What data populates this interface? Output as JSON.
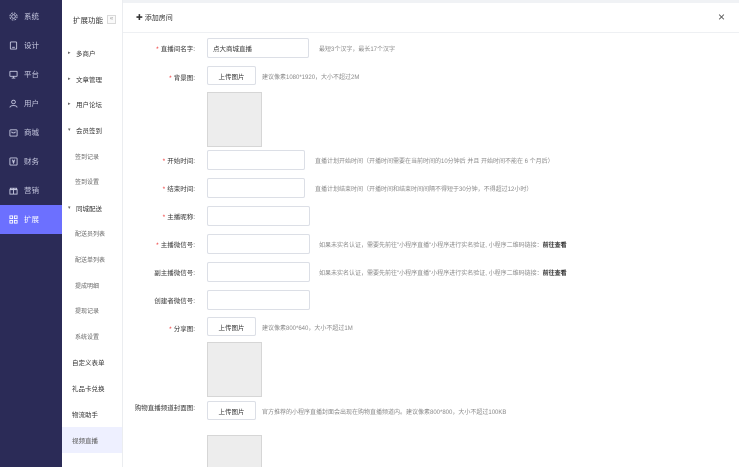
{
  "nav": {
    "items": [
      {
        "label": "系统",
        "icon": "gear-icon",
        "active": false
      },
      {
        "label": "设计",
        "icon": "design-icon",
        "active": false
      },
      {
        "label": "平台",
        "icon": "monitor-icon",
        "active": false
      },
      {
        "label": "用户",
        "icon": "user-icon",
        "active": false
      },
      {
        "label": "商城",
        "icon": "shop-icon",
        "active": false
      },
      {
        "label": "财务",
        "icon": "finance-icon",
        "active": false
      },
      {
        "label": "营销",
        "icon": "marketing-icon",
        "active": false
      },
      {
        "label": "扩展",
        "icon": "grid-icon",
        "active": true
      }
    ]
  },
  "sub": {
    "title": "扩展功能",
    "collapse_glyph": "«",
    "items": [
      {
        "label": "多商户",
        "type": "group"
      },
      {
        "label": "文章管理",
        "type": "group"
      },
      {
        "label": "用户论坛",
        "type": "group"
      },
      {
        "label": "会员签到",
        "type": "group-open"
      },
      {
        "label": "签到记录",
        "type": "child"
      },
      {
        "label": "签到设置",
        "type": "child"
      },
      {
        "label": "同城配送",
        "type": "group-open"
      },
      {
        "label": "配送员列表",
        "type": "child"
      },
      {
        "label": "配送单列表",
        "type": "child"
      },
      {
        "label": "提成明细",
        "type": "child"
      },
      {
        "label": "提现记录",
        "type": "child"
      },
      {
        "label": "系统设置",
        "type": "child"
      },
      {
        "label": "自定义表单",
        "type": "plain"
      },
      {
        "label": "礼品卡兑换",
        "type": "plain"
      },
      {
        "label": "物流助手",
        "type": "plain"
      },
      {
        "label": "视频直播",
        "type": "plain-active"
      }
    ]
  },
  "panel": {
    "title": "添加房间",
    "title_prefix": "✚",
    "close_glyph": "×"
  },
  "form": {
    "room_name": {
      "label": "直播间名字:",
      "value": "点大商城直播",
      "hint": "最短3个汉字，最长17个汉字"
    },
    "background": {
      "label": "背景图:",
      "button": "上传图片",
      "hint": "建议像素1080*1920，大小不超过2M"
    },
    "start_time": {
      "label": "开始时间:",
      "value": "",
      "hint": "直播计划开始时间（开播时间需要在当前时间的10分钟后 并且 开始时间不能在 6 个月后）"
    },
    "end_time": {
      "label": "结束时间:",
      "value": "",
      "hint": "直播计划结束时间（开播时间和结束时间间隔不得短于30分钟，不得超过12小时）"
    },
    "anchor_nick": {
      "label": "主播昵称:",
      "value": ""
    },
    "anchor_wechat": {
      "label": "主播微信号:",
      "value": "",
      "hint": "如果未实名认证，需要先前往\"小程序直播\"小程序进行实名验证, 小程序二维码链接：",
      "link": "前往查看"
    },
    "sub_anchor_wechat": {
      "label": "副主播微信号:",
      "value": "",
      "hint": "如果未实名认证，需要先前往\"小程序直播\"小程序进行实名验证, 小程序二维码链接：",
      "link": "前往查看"
    },
    "creator_wechat": {
      "label": "创建者微信号:",
      "value": ""
    },
    "share_image": {
      "label": "分享图:",
      "button": "上传图片",
      "hint": "建议像素800*640，大小不超过1M"
    },
    "cover_image": {
      "label": "购物直播频道封面图:",
      "button": "上传图片",
      "hint": "官方推荐的小程序直播封面会出现在购物直播频道内。建议像素800*800，大小不超过100KB"
    }
  }
}
